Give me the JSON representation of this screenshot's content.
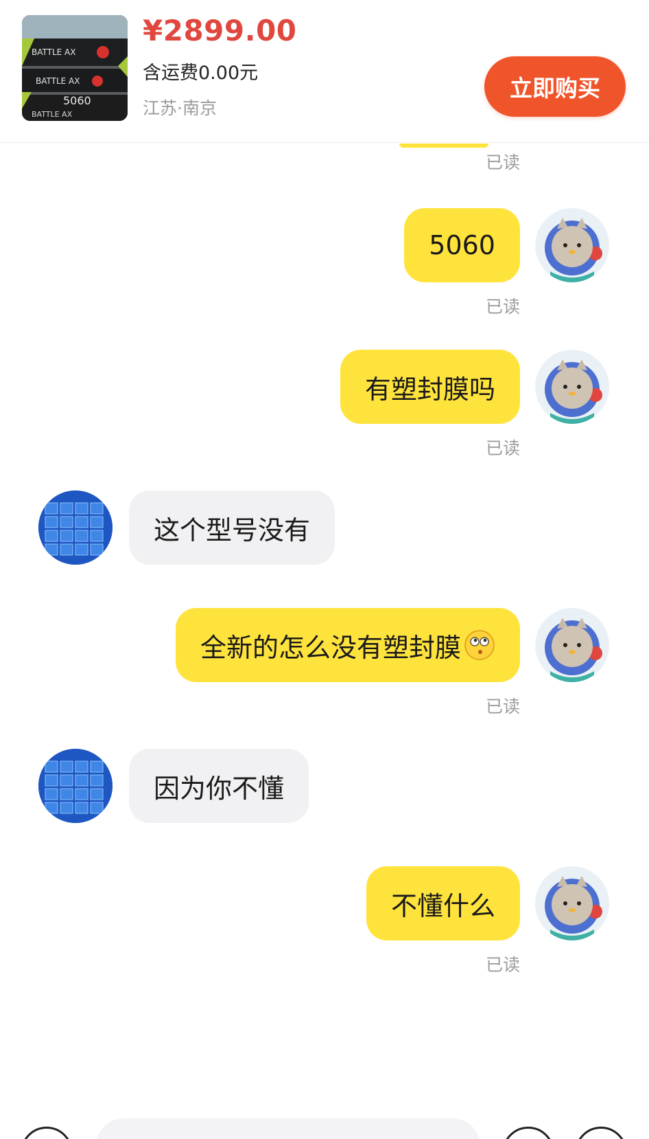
{
  "product": {
    "price": "¥2899.00",
    "shipping": "含运费0.00元",
    "location": "江苏·南京",
    "buy_button": "立即购买",
    "thumb_text": [
      "BATTLE AX",
      "BATTLE AX",
      "5060",
      "BATTLE AX"
    ]
  },
  "chat": {
    "messages": [
      {
        "from": "me",
        "text": "5060",
        "status": "已读"
      },
      {
        "from": "me",
        "text": "有塑封膜吗",
        "status": "已读"
      },
      {
        "from": "seller",
        "text": "这个型号没有"
      },
      {
        "from": "me",
        "text": "全新的怎么没有塑封膜",
        "emoji": "thinking-face-icon",
        "status": "已读"
      },
      {
        "from": "seller",
        "text": "因为你不懂"
      },
      {
        "from": "me",
        "text": "不懂什么",
        "status": "已读"
      }
    ],
    "top_partial_status": "已读"
  },
  "colors": {
    "price": "#e0473f",
    "buy_button": "#f0542a",
    "my_bubble": "#ffe33d",
    "seller_bubble": "#f1f1f3",
    "read_status": "#9c9c9c"
  }
}
